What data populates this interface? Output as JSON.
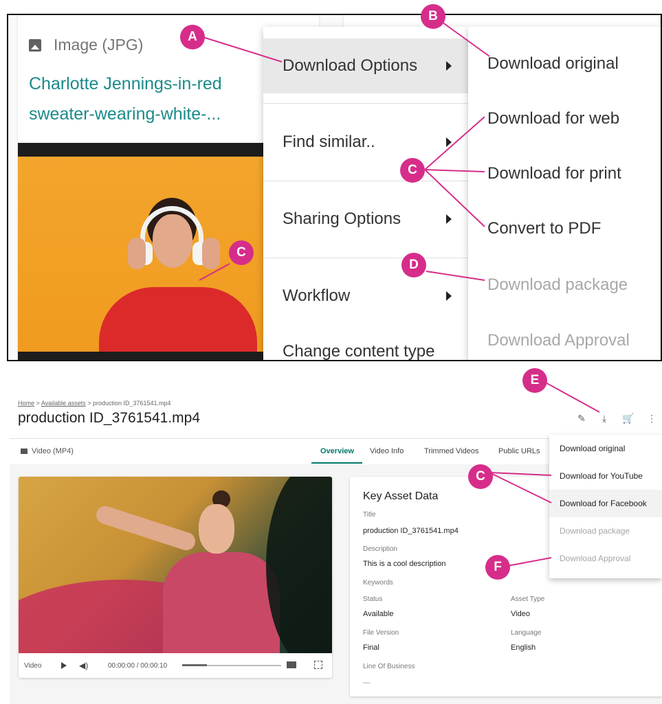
{
  "top": {
    "asset_type": "Image (JPG)",
    "asset_name_line1": "Charlotte Jennings-in-red",
    "asset_name_line2": "sweater-wearing-white-...",
    "context_menu": [
      {
        "label": "Download Options",
        "highlighted": true
      },
      {
        "label": "Find similar..",
        "highlighted": false
      },
      {
        "label": "Sharing Options",
        "highlighted": false
      },
      {
        "label": "Workflow",
        "highlighted": false
      },
      {
        "label": "Change content type",
        "highlighted": false
      }
    ],
    "download_submenu": [
      {
        "label": "Download original",
        "disabled": false
      },
      {
        "label": "Download for web",
        "disabled": false
      },
      {
        "label": "Download for print",
        "disabled": false
      },
      {
        "label": "Convert to PDF",
        "disabled": false
      },
      {
        "label": "Download package",
        "disabled": true
      },
      {
        "label": "Download Approval",
        "disabled": true
      }
    ]
  },
  "bottom": {
    "breadcrumb": {
      "home": "Home",
      "sep": ">",
      "available": "Available assets",
      "current": "production ID_3761541.mp4"
    },
    "title": "production ID_3761541.mp4",
    "asset_type": "Video (MP4)",
    "tabs": [
      "Overview",
      "Video Info",
      "Trimmed Videos",
      "Public URLs"
    ],
    "active_tab": "Overview",
    "player": {
      "label": "Video",
      "time": "00:00:00 / 00:00:10",
      "progress": 0.25
    },
    "key_asset_data": {
      "heading": "Key Asset Data",
      "title_label": "Title",
      "title_value": "production ID_3761541.mp4",
      "description_label": "Description",
      "description_value": "This is a cool description",
      "keywords_label": "Keywords",
      "status_label": "Status",
      "status_value": "Available",
      "asset_type_label": "Asset Type",
      "asset_type_value": "Video",
      "file_version_label": "File Version",
      "file_version_value": "Final",
      "language_label": "Language",
      "language_value": "English",
      "line_of_business_label": "Line Of Business",
      "line_of_business_value": "—"
    },
    "download_menu": [
      {
        "label": "Download original",
        "disabled": false,
        "highlighted": false
      },
      {
        "label": "Download for YouTube",
        "disabled": false,
        "highlighted": false
      },
      {
        "label": "Download for Facebook",
        "disabled": false,
        "highlighted": true
      },
      {
        "label": "Download package",
        "disabled": true,
        "highlighted": false
      },
      {
        "label": "Download Approval",
        "disabled": true,
        "highlighted": false
      }
    ]
  },
  "callouts": {
    "a": "A",
    "b": "B",
    "c": "C",
    "d": "D",
    "e": "E",
    "f": "F"
  },
  "colors": {
    "callout": "#d62d8a",
    "link": "#1b8a8a",
    "accent": "#00796b"
  },
  "icons": [
    "image-icon",
    "chevron-right-icon",
    "edit-icon",
    "download-icon",
    "add-to-cart-icon",
    "more-vert-icon",
    "video-icon",
    "play-icon",
    "volume-icon",
    "captions-icon",
    "fullscreen-icon"
  ]
}
